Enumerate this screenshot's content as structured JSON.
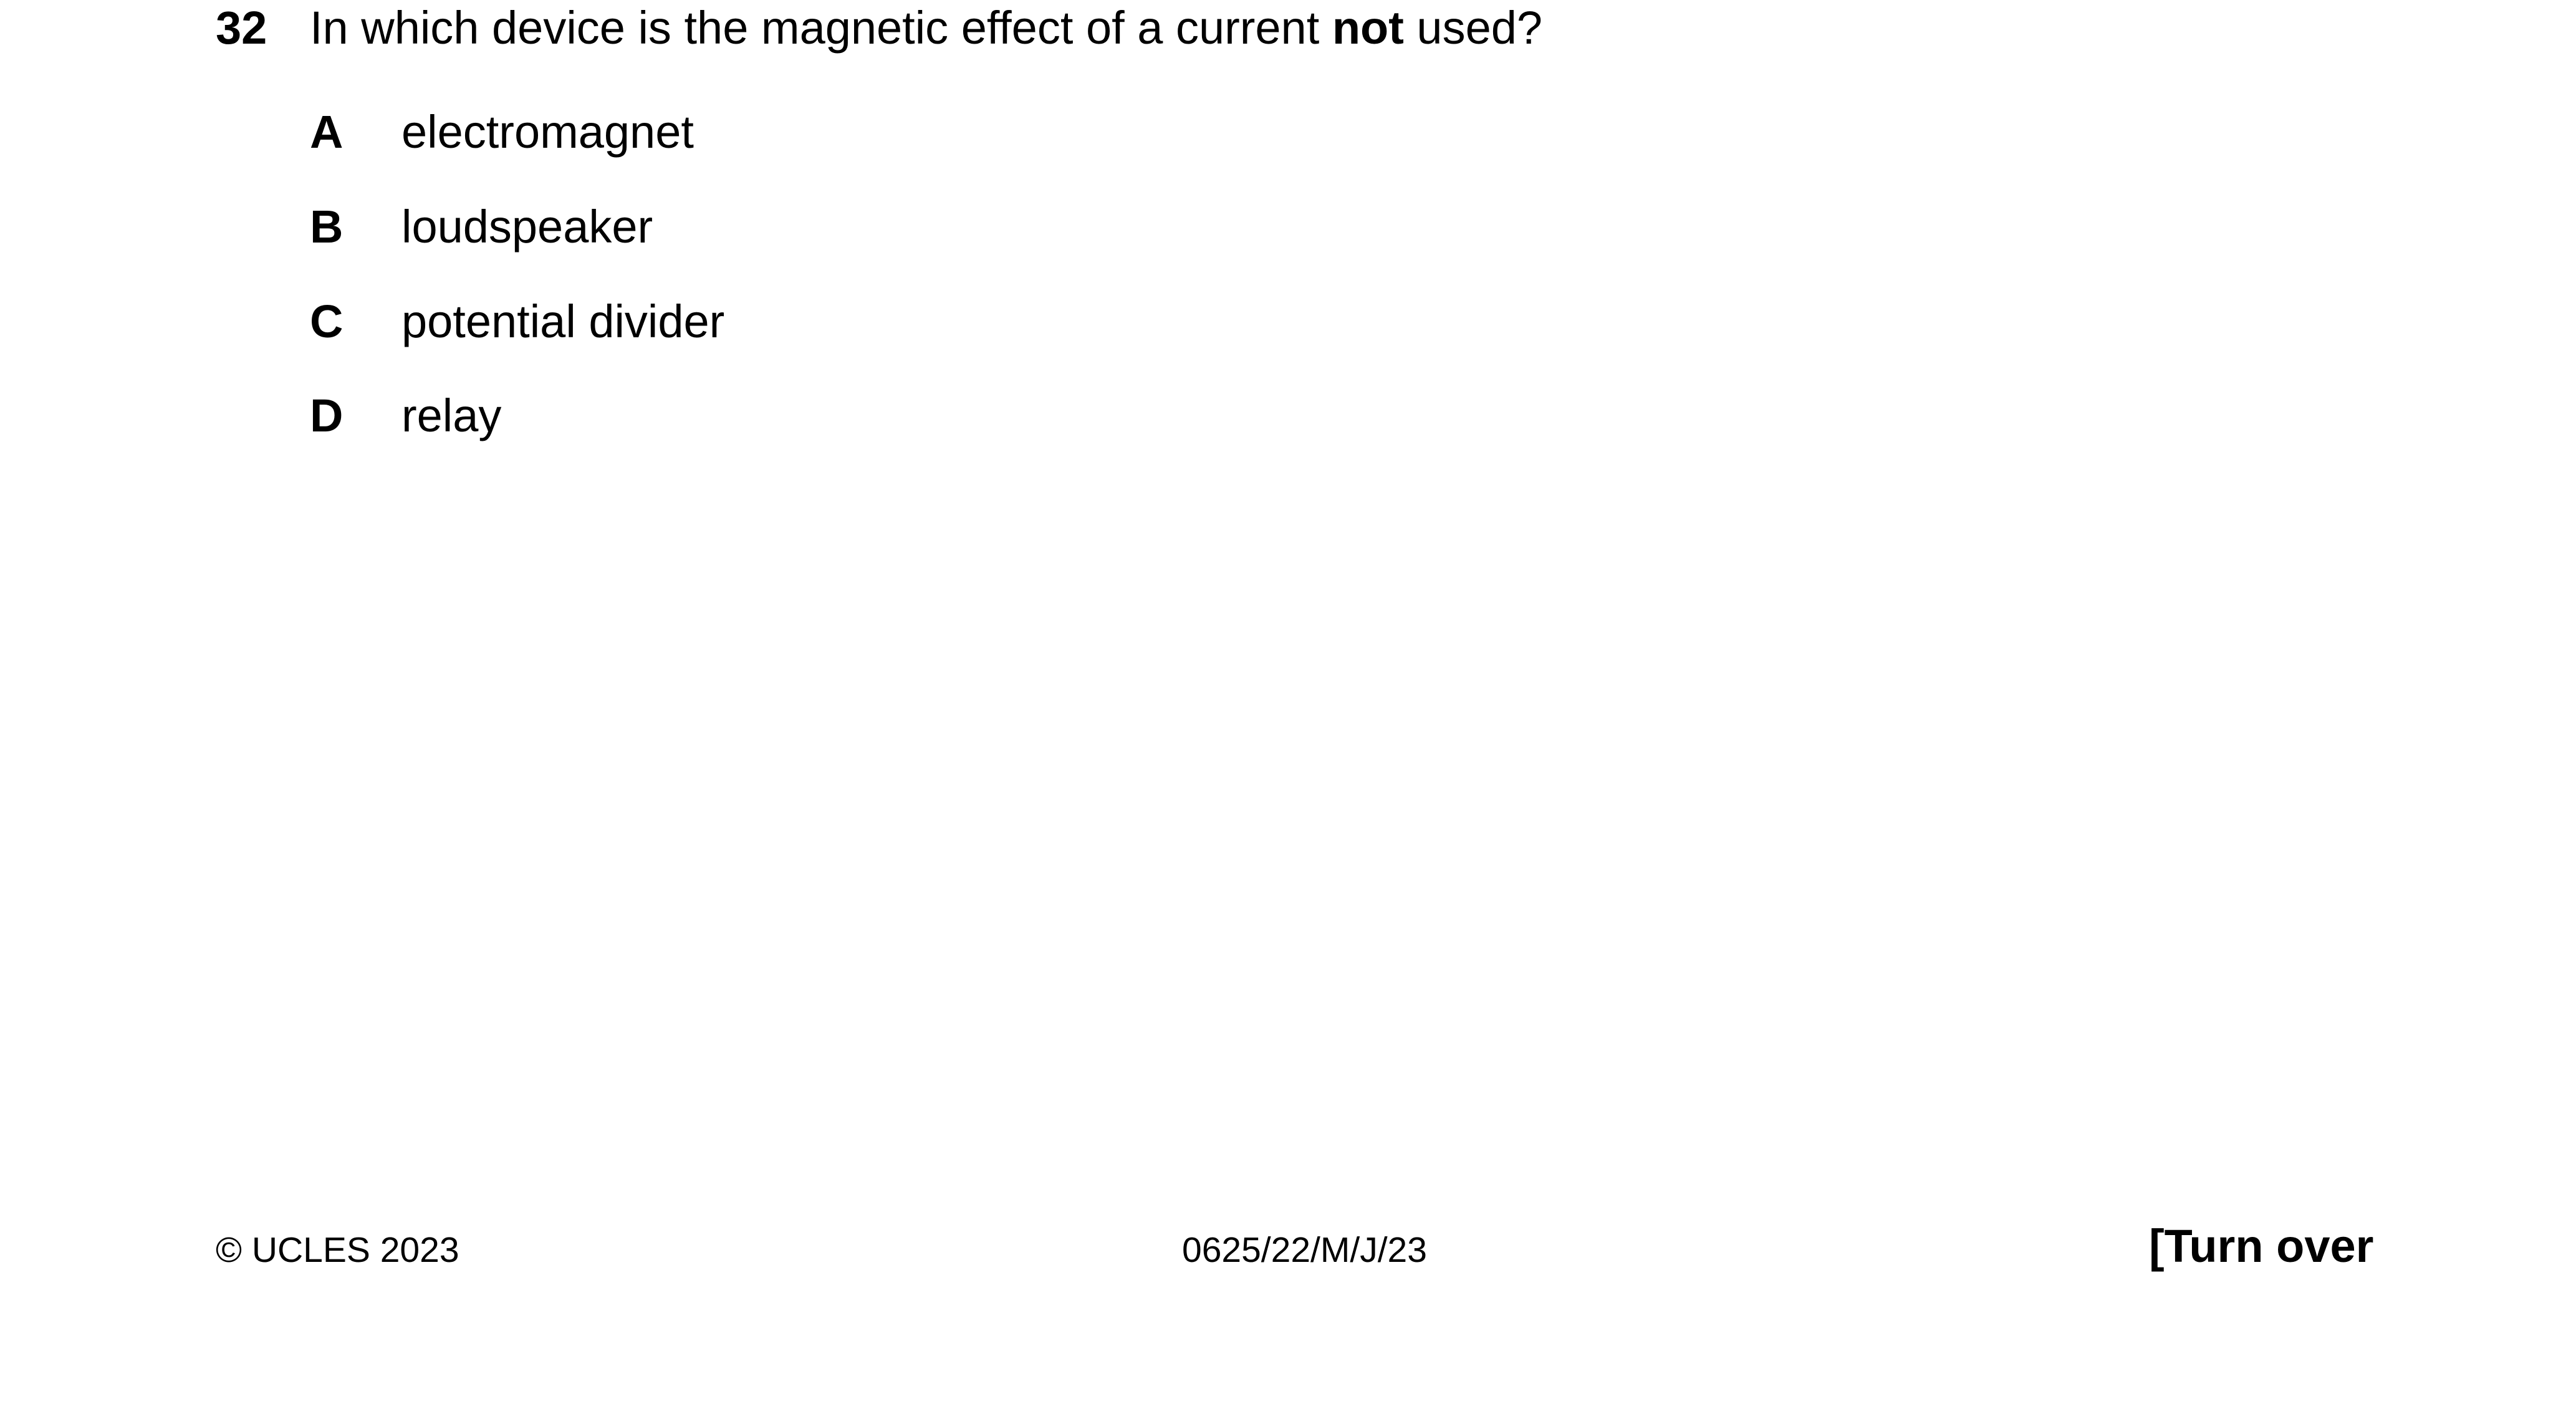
{
  "question": {
    "number": "32",
    "stem_before": "In which device is the magnetic effect of a current ",
    "stem_emphasis": "not",
    "stem_after": " used?"
  },
  "options": [
    {
      "letter": "A",
      "text": "electromagnet"
    },
    {
      "letter": "B",
      "text": "loudspeaker"
    },
    {
      "letter": "C",
      "text": "potential divider"
    },
    {
      "letter": "D",
      "text": "relay"
    }
  ],
  "footer": {
    "copyright": "© UCLES 2023",
    "paper_code": "0625/22/M/J/23",
    "turn_over": "[Turn over"
  }
}
